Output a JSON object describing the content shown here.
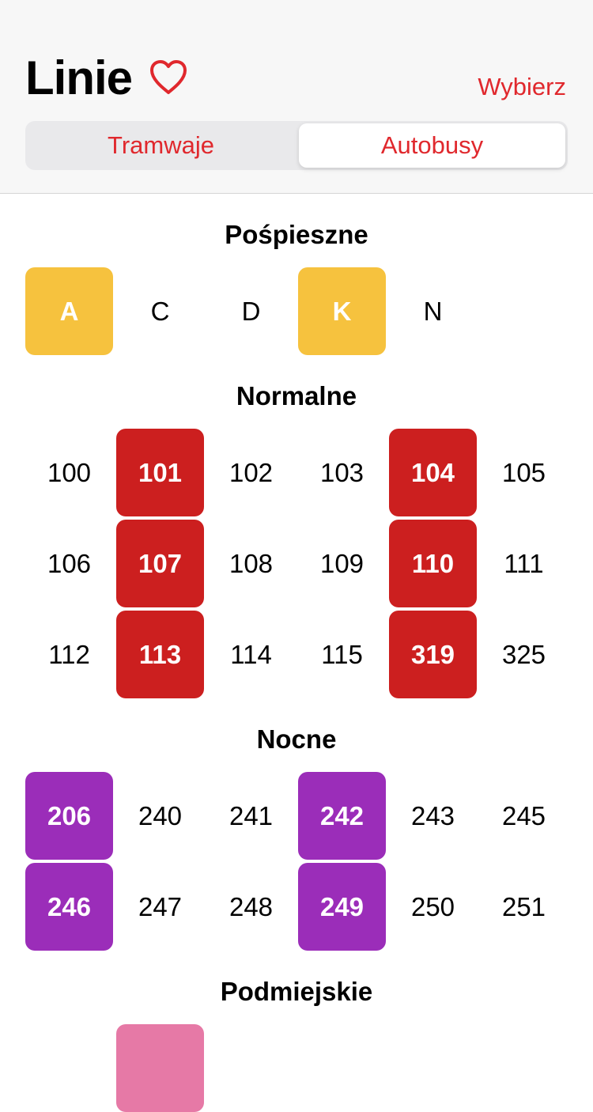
{
  "header": {
    "title": "Linie",
    "select_label": "Wybierz",
    "tabs": [
      {
        "label": "Tramwaje",
        "active": false
      },
      {
        "label": "Autobusy",
        "active": true
      }
    ]
  },
  "colors": {
    "accent": "#e0282d",
    "express": "#f6c23e",
    "normal": "#cc1f1f",
    "night": "#9b2db9",
    "suburban": "#e679a6"
  },
  "sections": [
    {
      "title": "Pośpieszne",
      "color": "#f6c23e",
      "rows": [
        [
          {
            "label": "A",
            "hl": true
          },
          {
            "label": "C",
            "hl": false
          },
          {
            "label": "D",
            "hl": false
          },
          {
            "label": "K",
            "hl": true
          },
          {
            "label": "N",
            "hl": false
          }
        ]
      ]
    },
    {
      "title": "Normalne",
      "color": "#cc1f1f",
      "rows": [
        [
          {
            "label": "100",
            "hl": false
          },
          {
            "label": "101",
            "hl": true
          },
          {
            "label": "102",
            "hl": false
          },
          {
            "label": "103",
            "hl": false
          },
          {
            "label": "104",
            "hl": true
          },
          {
            "label": "105",
            "hl": false
          }
        ],
        [
          {
            "label": "106",
            "hl": false
          },
          {
            "label": "107",
            "hl": true
          },
          {
            "label": "108",
            "hl": false
          },
          {
            "label": "109",
            "hl": false
          },
          {
            "label": "110",
            "hl": true
          },
          {
            "label": "111",
            "hl": false
          }
        ],
        [
          {
            "label": "112",
            "hl": false
          },
          {
            "label": "113",
            "hl": true
          },
          {
            "label": "114",
            "hl": false
          },
          {
            "label": "115",
            "hl": false
          },
          {
            "label": "319",
            "hl": true
          },
          {
            "label": "325",
            "hl": false
          }
        ]
      ]
    },
    {
      "title": "Nocne",
      "color": "#9b2db9",
      "rows": [
        [
          {
            "label": "206",
            "hl": true
          },
          {
            "label": "240",
            "hl": false
          },
          {
            "label": "241",
            "hl": false
          },
          {
            "label": "242",
            "hl": true
          },
          {
            "label": "243",
            "hl": false
          },
          {
            "label": "245",
            "hl": false
          }
        ],
        [
          {
            "label": "246",
            "hl": true
          },
          {
            "label": "247",
            "hl": false
          },
          {
            "label": "248",
            "hl": false
          },
          {
            "label": "249",
            "hl": true
          },
          {
            "label": "250",
            "hl": false
          },
          {
            "label": "251",
            "hl": false
          }
        ]
      ]
    },
    {
      "title": "Podmiejskie",
      "color": "#e679a6",
      "rows": [
        [
          {
            "label": "",
            "hl": false
          },
          {
            "label": "",
            "hl": true
          }
        ]
      ]
    }
  ]
}
